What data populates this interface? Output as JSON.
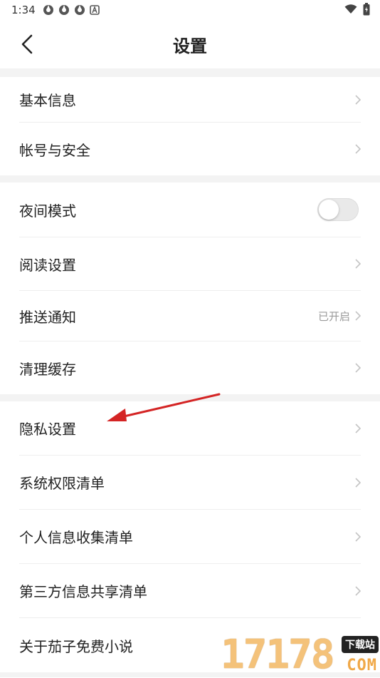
{
  "status_bar": {
    "time": "1:34"
  },
  "header": {
    "title": "设置"
  },
  "sections": [
    {
      "items": [
        {
          "label": "基本信息"
        },
        {
          "label": "帐号与安全"
        }
      ]
    },
    {
      "items": [
        {
          "label": "夜间模式",
          "toggle": false
        },
        {
          "label": "阅读设置"
        },
        {
          "label": "推送通知",
          "value": "已开启"
        },
        {
          "label": "清理缓存"
        }
      ]
    },
    {
      "items": [
        {
          "label": "隐私设置"
        },
        {
          "label": "系统权限清单"
        },
        {
          "label": "个人信息收集清单"
        },
        {
          "label": "第三方信息共享清单"
        },
        {
          "label": "关于茄子免费小说"
        }
      ]
    }
  ],
  "watermark": {
    "number": "17178",
    "tag": "下载站",
    "suffix": "COM"
  },
  "colors": {
    "annotation_arrow": "#d42424",
    "divider": "#eeeeee",
    "section_gap": "#f3f3f3"
  }
}
